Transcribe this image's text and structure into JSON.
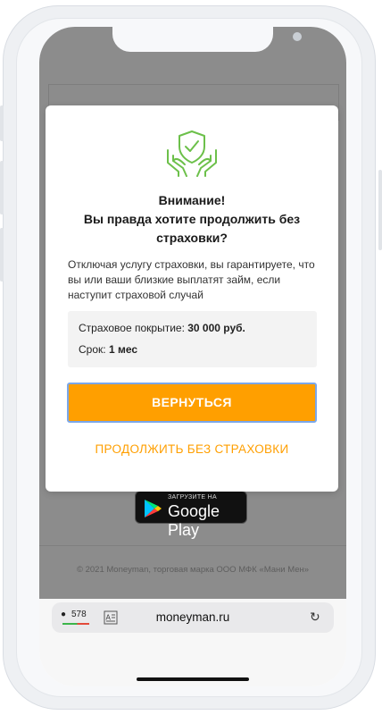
{
  "modal": {
    "title_line1": "Внимание!",
    "title_line2": "Вы правда хотите продолжить без",
    "title_line3": "страховки?",
    "description": "Отключая услугу страховки, вы гарантируете, что вы или ваши близкие выплатят займ, если наступит страховой случай",
    "coverage_label": "Страховое покрытие:",
    "coverage_value": "30 000 руб.",
    "term_label": "Срок:",
    "term_value": "1 мес",
    "primary_button": "ВЕРНУТЬСЯ",
    "secondary_button": "ПРОДОЛЖИТЬ БЕЗ СТРАХОВКИ",
    "icon": "insurance-shield-hands-icon",
    "accent_color": "#ff9f00",
    "icon_color": "#6cc04a"
  },
  "background_page": {
    "store_badge_small": "ЗАГРУЗИТЕ НА",
    "store_badge_big": "Google Play",
    "copyright": "© 2021 Moneyman, торговая марка ООО МФК «Мани Мен»"
  },
  "browser": {
    "extension_count": "578",
    "url": "moneyman.ru",
    "reader_icon": "reader-mode-icon",
    "reload_icon": "reload-icon"
  }
}
